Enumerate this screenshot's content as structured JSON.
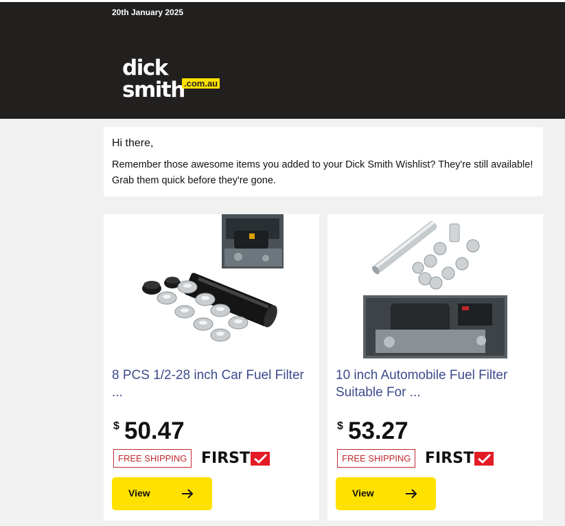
{
  "header": {
    "date": "20th January 2025",
    "logo_word": "dick smith",
    "logo_domain": ".com.au"
  },
  "greeting": {
    "hi": "Hi there,",
    "message": "Remember those awesome items you added to your Dick Smith Wishlist? They're still available! Grab them quick before they're gone."
  },
  "products": [
    {
      "title": "8 PCS 1/2-28 inch Car Fuel Filter ...",
      "currency": "$",
      "price": "50.47",
      "shipping": "FREE SHIPPING",
      "badge": "FIRST",
      "button": "View"
    },
    {
      "title": "10 inch Automobile Fuel Filter Suitable For ...",
      "currency": "$",
      "price": "53.27",
      "shipping": "FREE SHIPPING",
      "badge": "FIRST",
      "button": "View"
    }
  ],
  "colors": {
    "header_bg": "#221f1f",
    "brand_yellow": "#ffe100",
    "title_blue": "#3c4a8c",
    "shipping_red": "#c0272d",
    "first_red": "#e21b25"
  }
}
